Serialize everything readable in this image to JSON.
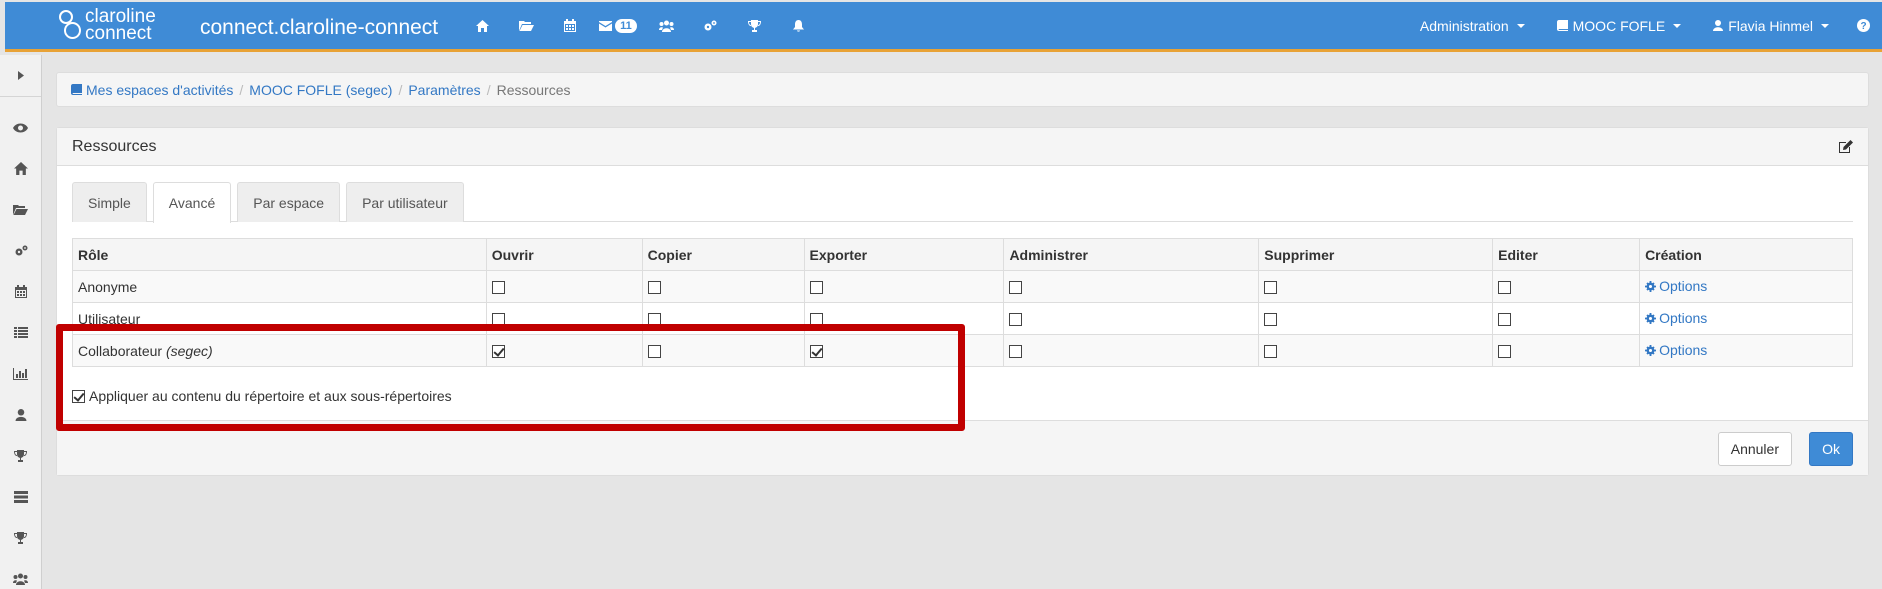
{
  "topbar": {
    "logo_line1": "claroline",
    "logo_line2": "connect",
    "site_name": "connect.claroline-connect",
    "icons": [
      "home-icon",
      "folder-icon",
      "calendar-icon",
      "envelope-icon",
      "users-icon",
      "cogs-icon",
      "trophy-icon",
      "bell-icon"
    ],
    "message_count": "11",
    "admin_label": "Administration",
    "workspace_label": "MOOC FOFLE",
    "user_label": "Flavia Hinmel"
  },
  "sidebar": {
    "icons": [
      "eye-icon",
      "home-icon",
      "folder-icon",
      "cogs-icon",
      "calendar-icon",
      "list-icon",
      "bar-chart-icon",
      "user-icon",
      "trophy-icon",
      "server-icon",
      "trophy-icon",
      "users-icon"
    ]
  },
  "breadcrumb": {
    "items": [
      "Mes espaces d'activités",
      "MOOC FOFLE (segec)",
      "Paramètres"
    ],
    "current": "Ressources"
  },
  "panel": {
    "title": "Ressources",
    "tabs": [
      "Simple",
      "Avancé",
      "Par espace",
      "Par utilisateur"
    ],
    "active_tab": "Avancé",
    "columns": [
      "Rôle",
      "Ouvrir",
      "Copier",
      "Exporter",
      "Administrer",
      "Supprimer",
      "Editer",
      "Création"
    ],
    "rows": [
      {
        "role": "Anonyme",
        "role_suffix": "",
        "ouvrir": false,
        "copier": false,
        "exporter": false,
        "administrer": false,
        "supprimer": false,
        "editer": false,
        "creation": "Options"
      },
      {
        "role": "Utilisateur",
        "role_suffix": "",
        "ouvrir": false,
        "copier": false,
        "exporter": false,
        "administrer": false,
        "supprimer": false,
        "editer": false,
        "creation": "Options"
      },
      {
        "role": "Collaborateur",
        "role_suffix": "(segec)",
        "ouvrir": true,
        "copier": false,
        "exporter": true,
        "administrer": false,
        "supprimer": false,
        "editer": false,
        "creation": "Options"
      }
    ],
    "apply_label": "Appliquer au contenu du répertoire et aux sous-répertoires",
    "apply_checked": true,
    "cancel_label": "Annuler",
    "ok_label": "Ok"
  },
  "colors": {
    "topbar": "#3f8bd6",
    "topbar_accent": "#e8a236",
    "link": "#3378c4",
    "highlight": "#c00000"
  }
}
